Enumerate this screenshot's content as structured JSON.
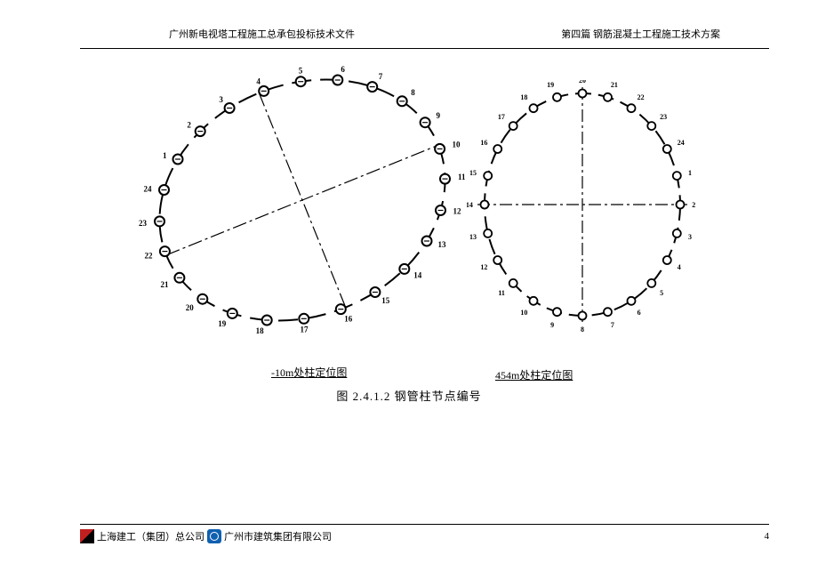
{
  "header": {
    "left": "广州新电视塔工程施工总承包投标技术文件",
    "right": "第四篇  钢筋混凝土工程施工技术方案"
  },
  "diagrams": {
    "left": {
      "caption": "-10m处柱定位图",
      "node_count": 24
    },
    "right": {
      "caption": "454m处柱定位图",
      "node_count": 24
    }
  },
  "figure_label": "图 2.4.1.2  钢管柱节点编号",
  "footer": {
    "company1": "上海建工（集团）总公司",
    "company2": "广州市建筑集团有限公司",
    "page": "4"
  }
}
